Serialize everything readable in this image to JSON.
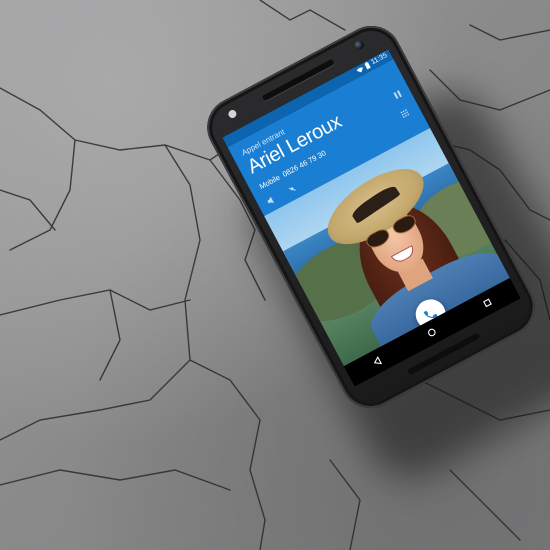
{
  "scene": {
    "description_type": "product photo of smartphone on cracked concrete"
  },
  "phone": {
    "status": {
      "time": "11:35"
    },
    "call": {
      "label": "Appel entrant",
      "caller_name": "Ariel Leroux",
      "number_type": "Mobile",
      "number": "0826 46 79 30"
    },
    "icons": {
      "answer": "phone-icon",
      "back": "back-triangle-icon",
      "home": "home-circle-icon",
      "recents": "recents-square-icon"
    },
    "colors": {
      "header_blue": "#1a7fd3",
      "status_blue": "#0d64b0"
    }
  }
}
